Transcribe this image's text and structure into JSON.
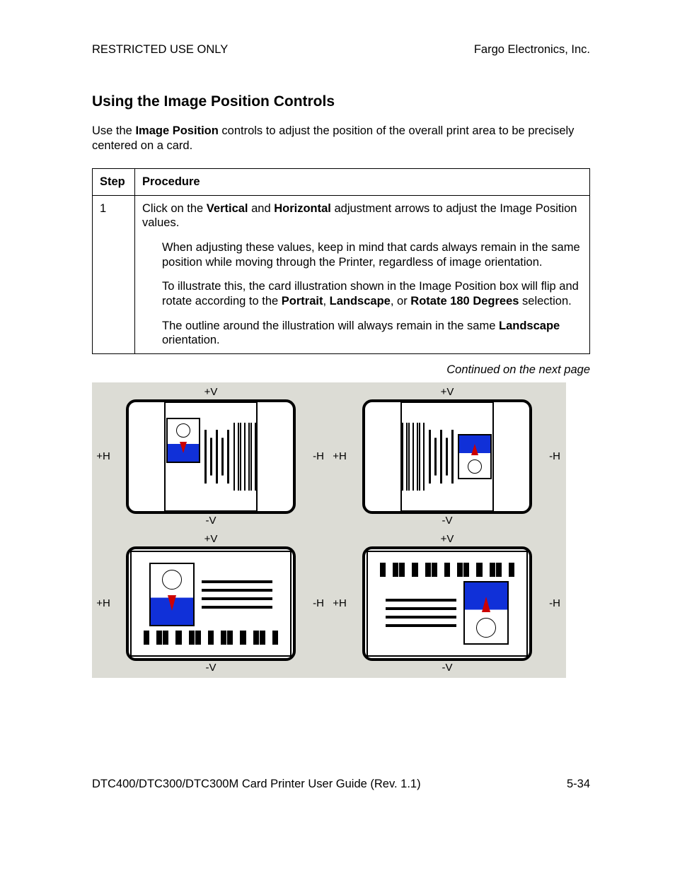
{
  "header": {
    "left": "RESTRICTED USE ONLY",
    "right": "Fargo Electronics, Inc."
  },
  "title": "Using the Image Position Controls",
  "intro": {
    "pre": "Use the ",
    "bold": "Image Position",
    "post": " controls to adjust the position of the overall print area to be precisely centered on a card."
  },
  "table": {
    "head_step": "Step",
    "head_proc": "Procedure",
    "step_num": "1",
    "p1_a": "Click on the ",
    "p1_b1": "Vertical",
    "p1_mid": " and ",
    "p1_b2": "Horizontal",
    "p1_c": " adjustment arrows to adjust the Image Position values.",
    "p2": "When adjusting these values, keep in mind that cards always remain in the same position while moving through the Printer, regardless of image orientation.",
    "p3_a": "To illustrate this, the card illustration shown in the Image Position box will flip and rotate according to the ",
    "p3_b1": "Portrait",
    "p3_s1": ", ",
    "p3_b2": "Landscape",
    "p3_s2": ", or ",
    "p3_b3": "Rotate 180 Degrees",
    "p3_c": " selection.",
    "p4_a": "The outline around the illustration will always remain in the same ",
    "p4_b": "Landscape",
    "p4_c": " orientation."
  },
  "continued": "Continued on the next page",
  "labels": {
    "pv": "+V",
    "mv": "-V",
    "ph": "+H",
    "mh": "-H"
  },
  "footer": {
    "left": "DTC400/DTC300/DTC300M Card Printer User Guide (Rev. 1.1)",
    "right": "5-34"
  }
}
